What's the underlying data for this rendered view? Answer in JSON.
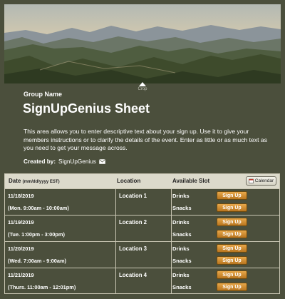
{
  "banner": {
    "crop_label": "Crop"
  },
  "group_name": "Group Name",
  "title": "SignUpGenius Sheet",
  "description": "This area allows you to enter descriptive text about your sign up. Use it to give your members instructions or to clarify the details of the event. Enter as little or as much text as you need to get your message across.",
  "created_by": {
    "label": "Created by:",
    "name": "SignUpGenius",
    "icon": "envelope-icon"
  },
  "table": {
    "headers": {
      "date": "Date",
      "date_format": "(mm/dd/yyyy EST)",
      "location": "Location",
      "slot": "Available Slot"
    },
    "calendar_label": "Calendar",
    "rows": [
      {
        "date": "11/18/2019",
        "time": "(Mon. 9:00am - 10:00am)",
        "location": "Location 1",
        "slots": [
          "Drinks",
          "Snacks"
        ]
      },
      {
        "date": "11/19/2019",
        "time": "(Tue. 1:00pm - 3:00pm)",
        "location": "Location 2",
        "slots": [
          "Drinks",
          "Snacks"
        ]
      },
      {
        "date": "11/20/2019",
        "time": "(Wed. 7:00am - 9:00am)",
        "location": "Location 3",
        "slots": [
          "Drinks",
          "Snacks"
        ]
      },
      {
        "date": "11/21/2019",
        "time": "(Thurs. 11:00am - 12:01pm)",
        "location": "Location 4",
        "slots": [
          "Drinks",
          "Snacks"
        ]
      }
    ],
    "signup_label": "Sign Up"
  },
  "colors": {
    "background": "#4b4f3c",
    "header": "#dcdacb",
    "button": "#c98a2e",
    "border": "#c9c6b3"
  }
}
